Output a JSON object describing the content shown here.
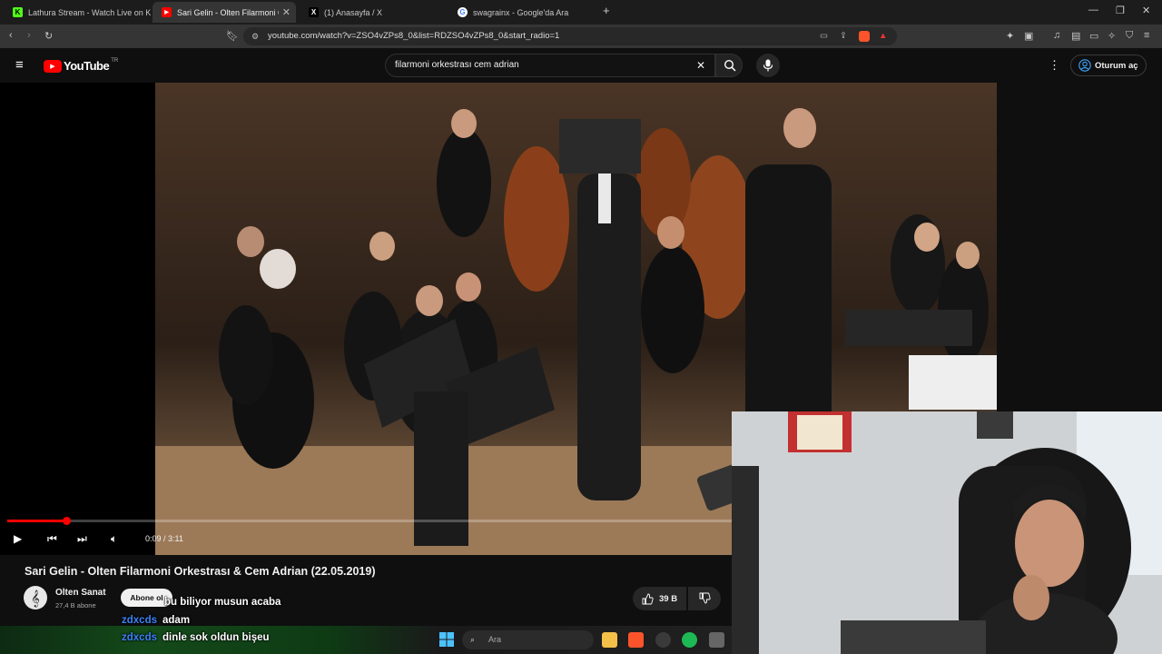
{
  "browser": {
    "tabs": [
      {
        "title": "Lathura Stream - Watch Live on Kick",
        "favicon": "K",
        "active": false
      },
      {
        "title": "Sari Gelin - Olten Filarmoni Orkestrası",
        "favicon": "▶",
        "active": true
      },
      {
        "title": "(1) Anasayfa / X",
        "favicon": "X",
        "active": false
      },
      {
        "title": "swagrainx - Google'da Ara",
        "favicon": "G",
        "active": false
      }
    ],
    "new_tab": "+",
    "url": "youtube.com/watch?v=ZSO4vZPs8_0&list=RDZSO4vZPs8_0&start_radio=1"
  },
  "youtube": {
    "logo_text": "YouTube",
    "logo_region": "TR",
    "search_query": "filarmoni orkestrası cem adrian",
    "signin_label": "Oturum aç",
    "accent": "#ff0000"
  },
  "player": {
    "time_current": "0:09",
    "time_total": "3:11",
    "time_display": "0:09 / 3:11",
    "progress_fraction": 0.081
  },
  "video": {
    "title": "Sari Gelin - Olten Filarmoni Orkestrası & Cem Adrian (22.05.2019)",
    "channel": "Olten Sanat",
    "subscribers": "27,4 B abone",
    "subscribe_label": "Abone ol",
    "likes": "39 B"
  },
  "chat": [
    {
      "user": "",
      "message": "bu biliyor musun acaba"
    },
    {
      "user": "zdxcds",
      "message": "adam"
    },
    {
      "user": "zdxcds",
      "message": "dinle sok oldun bişeu"
    }
  ],
  "taskbar": {
    "search_placeholder": "Ara"
  }
}
